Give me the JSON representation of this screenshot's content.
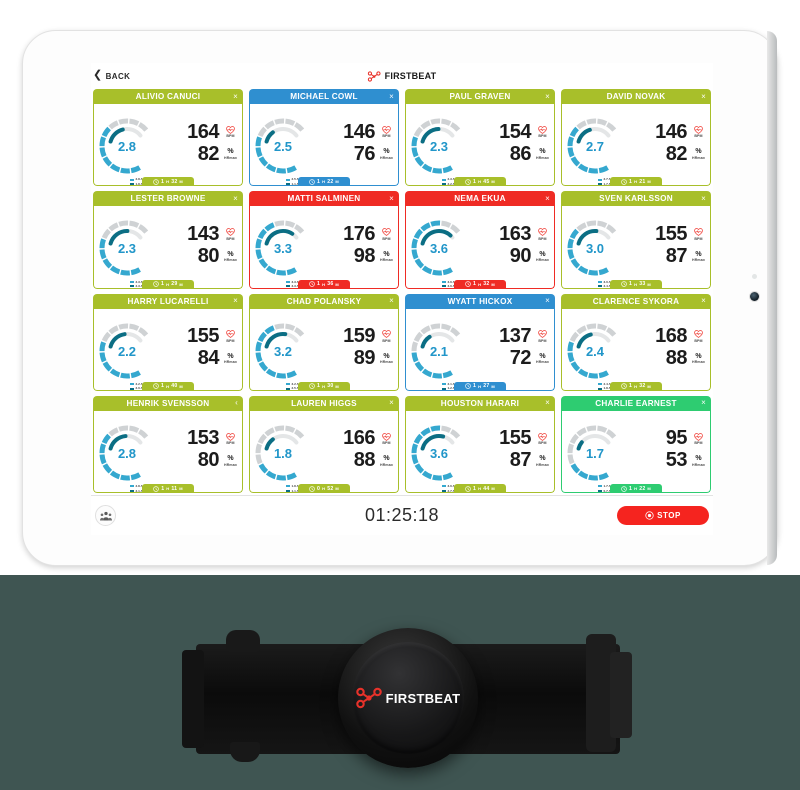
{
  "app": {
    "back_label": "BACK",
    "brand": "FIRSTBEAT",
    "back_icon": "chevron-left-icon",
    "logo_icon": "firstbeat-logo-icon"
  },
  "colors": {
    "olive": "#a8bf2a",
    "blue": "#2f8fd0",
    "red": "#ef2b24",
    "green": "#2ecc71",
    "aerobic": "#35a8cf",
    "anaerobic": "#0b6e84",
    "value_text": "#2196c9",
    "stop_red": "#f5241f",
    "track": "#cfd2d4"
  },
  "units": {
    "bpm": "BPM",
    "hrmax": "HRmax",
    "percent_glyph": "%",
    "hour": "H",
    "minute": "M"
  },
  "icons": {
    "heart": "heart-rate-icon",
    "clock": "clock-icon",
    "close": "close-icon",
    "chevron": "chevron-left-icon",
    "group": "group-people-icon",
    "stop": "stop-record-icon"
  },
  "cards": [
    {
      "name": "ALIVIO CANUCI",
      "color": "olive",
      "close": "x",
      "ti": "2.8",
      "bpm": "164",
      "hrmax": "82",
      "aerobic": "2.8 AEROBIC",
      "anaerobic": "1.8 ANAEROBIC",
      "time_h": "1",
      "time_m": "32",
      "ring_aerobic_pct": 62,
      "ring_anaerobic_pct": 38
    },
    {
      "name": "MICHAEL COWL",
      "color": "blue",
      "close": "x",
      "ti": "2.5",
      "bpm": "146",
      "hrmax": "76",
      "aerobic": "2.5 AEROBIC",
      "anaerobic": "1.1 ANAEROBIC",
      "time_h": "1",
      "time_m": "22",
      "ring_aerobic_pct": 56,
      "ring_anaerobic_pct": 24
    },
    {
      "name": "PAUL GRAVEN",
      "color": "olive",
      "close": "x",
      "ti": "2.3",
      "bpm": "154",
      "hrmax": "86",
      "aerobic": "2.3 AEROBIC",
      "anaerobic": "2.2 ANAEROBIC",
      "time_h": "1",
      "time_m": "45",
      "ring_aerobic_pct": 52,
      "ring_anaerobic_pct": 46
    },
    {
      "name": "DAVID NOVAK",
      "color": "olive",
      "close": "x",
      "ti": "2.7",
      "bpm": "146",
      "hrmax": "82",
      "aerobic": "2.7 AEROBIC",
      "anaerobic": "1.7 ANAEROBIC",
      "time_h": "1",
      "time_m": "21",
      "ring_aerobic_pct": 60,
      "ring_anaerobic_pct": 36
    },
    {
      "name": "LESTER BROWNE",
      "color": "olive",
      "close": "x",
      "ti": "2.3",
      "bpm": "143",
      "hrmax": "80",
      "aerobic": "2.3 AEROBIC",
      "anaerobic": "2.3 ANAEROBIC",
      "time_h": "1",
      "time_m": "29",
      "ring_aerobic_pct": 52,
      "ring_anaerobic_pct": 48
    },
    {
      "name": "MATTI SALMINEN",
      "color": "red",
      "close": "x",
      "ti": "3.3",
      "bpm": "176",
      "hrmax": "98",
      "aerobic": "3.3 AEROBIC",
      "anaerobic": "3.3 ANAEROBIC",
      "time_h": "1",
      "time_m": "36",
      "ring_aerobic_pct": 74,
      "ring_anaerobic_pct": 68
    },
    {
      "name": "NEMA EKUA",
      "color": "red",
      "close": "x",
      "ti": "3.6",
      "bpm": "163",
      "hrmax": "90",
      "aerobic": "3.6 AEROBIC",
      "anaerobic": "3.6 ANAEROBIC",
      "time_h": "1",
      "time_m": "32",
      "ring_aerobic_pct": 80,
      "ring_anaerobic_pct": 74
    },
    {
      "name": "SVEN KARLSSON",
      "color": "olive",
      "close": "x",
      "ti": "3.0",
      "bpm": "155",
      "hrmax": "87",
      "aerobic": "3.0 AEROBIC",
      "anaerobic": "2.4 ANAEROBIC",
      "time_h": "1",
      "time_m": "33",
      "ring_aerobic_pct": 66,
      "ring_anaerobic_pct": 50
    },
    {
      "name": "HARRY LUCARELLI",
      "color": "olive",
      "close": "x",
      "ti": "2.2",
      "bpm": "155",
      "hrmax": "84",
      "aerobic": "2.2 AEROBIC",
      "anaerobic": "2.0 ANAEROBIC",
      "time_h": "1",
      "time_m": "40",
      "ring_aerobic_pct": 50,
      "ring_anaerobic_pct": 42
    },
    {
      "name": "CHAD POLANSKY",
      "color": "olive",
      "close": "x",
      "ti": "3.2",
      "bpm": "159",
      "hrmax": "89",
      "aerobic": "3.2 AEROBIC",
      "anaerobic": "2.5 ANAEROBIC",
      "time_h": "1",
      "time_m": "30",
      "ring_aerobic_pct": 72,
      "ring_anaerobic_pct": 52
    },
    {
      "name": "WYATT HICKOX",
      "color": "blue",
      "close": "x",
      "ti": "2.1",
      "bpm": "137",
      "hrmax": "72",
      "aerobic": "2.1 AEROBIC",
      "anaerobic": "1.2 ANAEROBIC",
      "time_h": "1",
      "time_m": "27",
      "ring_aerobic_pct": 47,
      "ring_anaerobic_pct": 26
    },
    {
      "name": "CLARENCE SYKORA",
      "color": "olive",
      "close": "x",
      "ti": "2.4",
      "bpm": "168",
      "hrmax": "88",
      "aerobic": "2.4 AEROBIC",
      "anaerobic": "1.8 ANAEROBIC",
      "time_h": "1",
      "time_m": "32",
      "ring_aerobic_pct": 54,
      "ring_anaerobic_pct": 38
    },
    {
      "name": "HENRIK SVENSSON",
      "color": "olive",
      "close": "chevron",
      "ti": "2.8",
      "bpm": "153",
      "hrmax": "80",
      "aerobic": "2.8 AEROBIC",
      "anaerobic": "2.1 ANAEROBIC",
      "time_h": "1",
      "time_m": "11",
      "ring_aerobic_pct": 62,
      "ring_anaerobic_pct": 44
    },
    {
      "name": "LAUREN HIGGS",
      "color": "olive",
      "close": "x",
      "ti": "1.8",
      "bpm": "166",
      "hrmax": "88",
      "aerobic": "1.8 AEROBIC",
      "anaerobic": "1.1 ANAEROBIC",
      "time_h": "0",
      "time_m": "52",
      "ring_aerobic_pct": 40,
      "ring_anaerobic_pct": 24
    },
    {
      "name": "HOUSTON HARARI",
      "color": "olive",
      "close": "x",
      "ti": "3.6",
      "bpm": "155",
      "hrmax": "87",
      "aerobic": "3.6 AEROBIC",
      "anaerobic": "2.7 ANAEROBIC",
      "time_h": "1",
      "time_m": "44",
      "ring_aerobic_pct": 80,
      "ring_anaerobic_pct": 56
    },
    {
      "name": "CHARLIE EARNEST",
      "color": "green",
      "close": "x",
      "ti": "1.7",
      "bpm": "95",
      "hrmax": "53",
      "aerobic": "1.7 AEROBIC",
      "anaerobic": "0.7 ANAEROBIC",
      "time_h": "1",
      "time_m": "22",
      "ring_aerobic_pct": 38,
      "ring_anaerobic_pct": 15
    }
  ],
  "footer": {
    "timer": "01:25:18",
    "stop_label": "STOP",
    "group_label": "group"
  },
  "device": {
    "brand": "FIRSTBEAT"
  }
}
